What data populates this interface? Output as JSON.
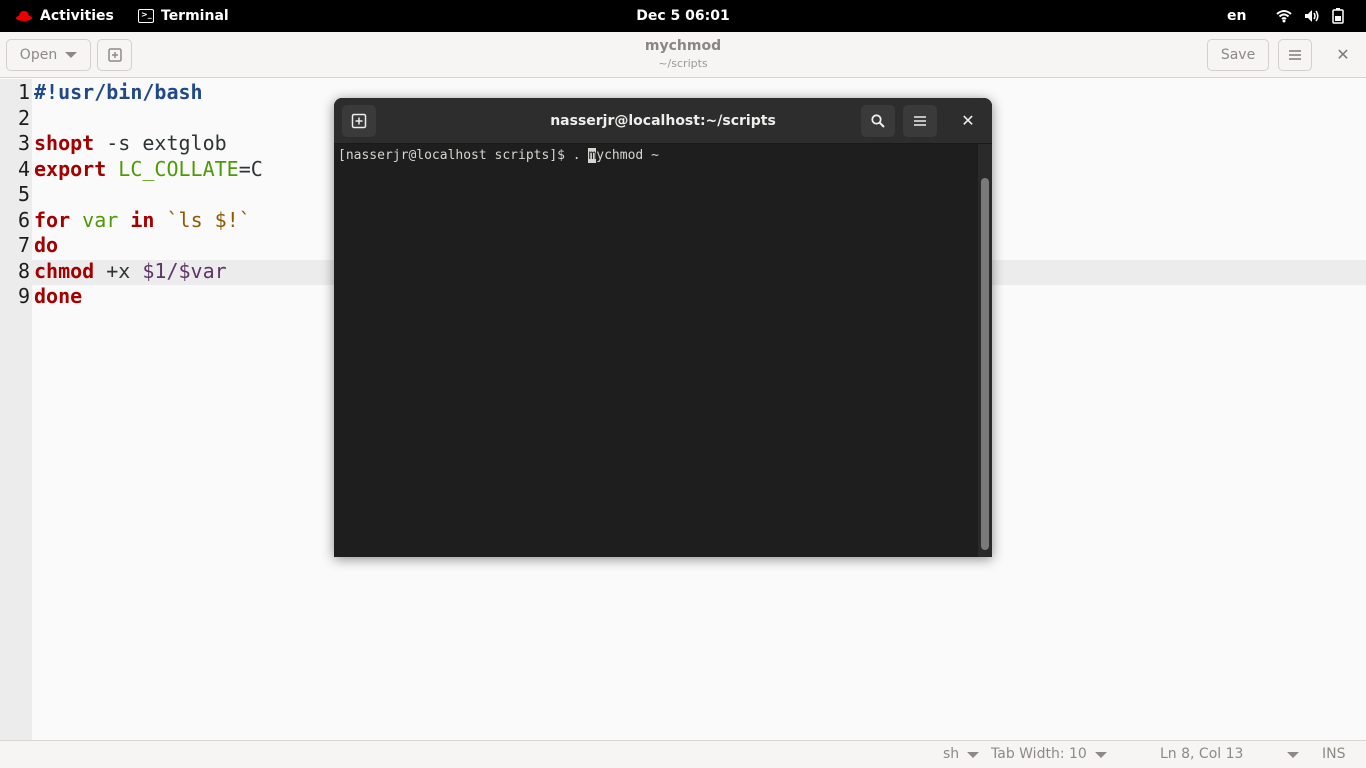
{
  "topbar": {
    "activities_label": "Activities",
    "app_name": "Terminal",
    "clock": "Dec 5  06:01",
    "language": "en"
  },
  "editor_window": {
    "open_label": "Open",
    "save_label": "Save",
    "title": "mychmod",
    "subtitle": "~/scripts",
    "lines": [
      {
        "n": "1"
      },
      {
        "n": "2"
      },
      {
        "n": "3"
      },
      {
        "n": "4"
      },
      {
        "n": "5"
      },
      {
        "n": "6"
      },
      {
        "n": "7"
      },
      {
        "n": "8"
      },
      {
        "n": "9"
      }
    ],
    "code": {
      "l1": "#!usr/bin/bash",
      "l3_kw": "shopt",
      "l3_rest": " -s extglob",
      "l4_kw": "export",
      "l4_var": "LC_COLLATE",
      "l4_rest": "=C",
      "l6_for": "for",
      "l6_var": "var",
      "l6_in": "in",
      "l6_str": "`ls $!`",
      "l7": "do",
      "l8_kw": "chmod",
      "l8_mid": " +x ",
      "l8_args": "$1/$var",
      "l9": "done"
    },
    "status": {
      "language": "sh",
      "tab_width": "Tab Width: 10",
      "position": "Ln 8, Col 13",
      "mode": "INS"
    }
  },
  "terminal_window": {
    "title": "nasserjr@localhost:~/scripts",
    "prompt": "[nasserjr@localhost scripts]$ . ",
    "cursor_char": "m",
    "command_rest": "ychmod ~"
  },
  "colors": {
    "keyword": "#a40000",
    "shebang": "#204a87",
    "variable": "#4e9a06",
    "terminal_bg": "#1e1e1e"
  }
}
